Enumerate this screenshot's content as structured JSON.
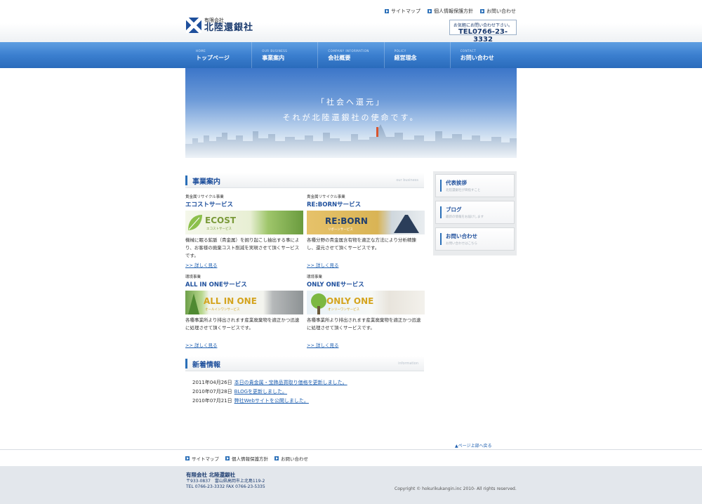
{
  "header": {
    "logo_sub": "有限会社",
    "logo_main": "北陸還銀社",
    "top_links": [
      "サイトマップ",
      "個人情報保護方針",
      "お問い合わせ"
    ],
    "tel_caption": "お気軽にお問い合わせ下さい。",
    "tel": "TEL0766-23-3332"
  },
  "nav": [
    {
      "en": "HOME",
      "jp": "トップページ"
    },
    {
      "en": "OUR BUSINESS",
      "jp": "事業案内"
    },
    {
      "en": "COMPANY INFORMATION",
      "jp": "会社概要"
    },
    {
      "en": "POLICY",
      "jp": "経営理念"
    },
    {
      "en": "CONTACT",
      "jp": "お問い合わせ"
    }
  ],
  "hero": {
    "line1": "「社会へ還元」",
    "line2": "それが北陸還銀社の使命です。"
  },
  "business": {
    "title": "事業案内",
    "title_en": "our business",
    "services": [
      {
        "category": "貴金属リサイクル事業",
        "name": "エコストサービス",
        "banner_label": "ECOST",
        "banner_sub": "エコストサービス",
        "desc": "機械に眠る鉱脈（貴金属）を掘り起こし抽出する事により、お客様の廃棄コスト削減を実現させて頂くサービスです。",
        "link": ">> 詳しく見る"
      },
      {
        "category": "貴金属リサイクル事業",
        "name": "RE:BORNサービス",
        "banner_label": "RE:BORN",
        "banner_sub": "リボーンサービス",
        "desc": "各種分野の貴金属含有物を適正な方法により分析精錬し、還元させて頂くサービスです。",
        "link": ">> 詳しく見る"
      },
      {
        "category": "環境事業",
        "name": "ALL IN ONEサービス",
        "banner_label": "ALL IN ONE",
        "banner_sub": "オールインワンサービス",
        "desc": "各種事業所より排出されます産業廃棄物を適正かつ迅速に処理させて頂くサービスです。",
        "link": ">> 詳しく見る"
      },
      {
        "category": "環境事業",
        "name": "ONLY ONEサービス",
        "banner_label": "ONLY ONE",
        "banner_sub": "オンリーワンサービス",
        "desc": "各種事業所より排出されます産業廃棄物を適正かつ迅速に処理させて頂くサービスです。",
        "link": ">> 詳しく見る"
      }
    ]
  },
  "side_menu": [
    {
      "title": "代表挨拶",
      "sub": "北陸還銀社が目指すこと"
    },
    {
      "title": "ブログ",
      "sub": "最新の情報をお届けします"
    },
    {
      "title": "お問い合わせ",
      "sub": "お問い合わせはこちら"
    }
  ],
  "news": {
    "title": "新着情報",
    "title_en": "information",
    "items": [
      {
        "date": "2011年04月26日",
        "text": "本日の貴金属・宝飾品買取り価格を更新しました。"
      },
      {
        "date": "2010年07月28日",
        "text": "BLOGを更新しました。"
      },
      {
        "date": "2010年07月21日",
        "text": "弊社Webサイトを公開しました。"
      }
    ]
  },
  "page_top": "▲ページ上部へ戻る",
  "footer": {
    "links": [
      "サイトマップ",
      "個人情報保護方針",
      "お問い合わせ"
    ],
    "company": "有限会社 北陸還銀社",
    "address": "〒933-0837　富山県高岡市上北島119-2",
    "tel_fax": "TEL 0766-23-3332 FAX 0766-23-5335",
    "copyright": "Copyright © hokurikukangin.inc 2010- All rights reserved."
  }
}
